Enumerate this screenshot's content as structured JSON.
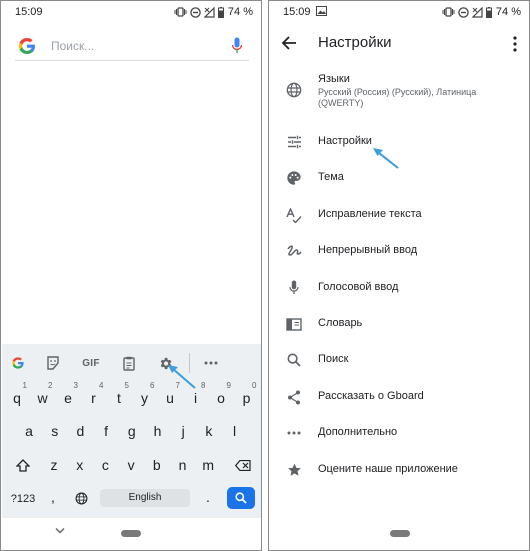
{
  "left_screen": {
    "status": {
      "time": "15:09",
      "battery": "74 %"
    },
    "search": {
      "placeholder": "Поиск..."
    },
    "keyboard": {
      "toolbar": {
        "icons": [
          "google-g-icon",
          "sticker-icon",
          "gif-icon",
          "clipboard-icon",
          "gear-icon",
          "more-horizontal-icon"
        ],
        "gif_label": "GIF"
      },
      "row1": [
        {
          "key": "q",
          "hint": "1"
        },
        {
          "key": "w",
          "hint": "2"
        },
        {
          "key": "e",
          "hint": "3"
        },
        {
          "key": "r",
          "hint": "4"
        },
        {
          "key": "t",
          "hint": "5"
        },
        {
          "key": "y",
          "hint": "6"
        },
        {
          "key": "u",
          "hint": "7"
        },
        {
          "key": "i",
          "hint": "8"
        },
        {
          "key": "o",
          "hint": "9"
        },
        {
          "key": "p",
          "hint": "0"
        }
      ],
      "row2": [
        "a",
        "s",
        "d",
        "f",
        "g",
        "h",
        "j",
        "k",
        "l"
      ],
      "row3": [
        "z",
        "x",
        "c",
        "v",
        "b",
        "n",
        "m"
      ],
      "row4": {
        "symbols": "?123",
        "comma": ",",
        "space": "English",
        "period": "."
      }
    }
  },
  "right_screen": {
    "status": {
      "time": "15:09",
      "battery": "74 %"
    },
    "appbar": {
      "title": "Настройки"
    },
    "menu": [
      {
        "icon": "globe-icon",
        "label": "Языки",
        "sub": "Русский (Россия) (Русский), Латиница (QWERTY)"
      },
      {
        "icon": "sliders-icon",
        "label": "Настройки"
      },
      {
        "icon": "palette-icon",
        "label": "Тема"
      },
      {
        "icon": "spellcheck-icon",
        "label": "Исправление текста"
      },
      {
        "icon": "gesture-icon",
        "label": "Непрерывный ввод"
      },
      {
        "icon": "mic-icon",
        "label": "Голосовой ввод"
      },
      {
        "icon": "book-icon",
        "label": "Словарь"
      },
      {
        "icon": "search-icon",
        "label": "Поиск"
      },
      {
        "icon": "share-icon",
        "label": "Рассказать о Gboard"
      },
      {
        "icon": "more-horizontal-icon",
        "label": "Дополнительно"
      },
      {
        "icon": "star-icon",
        "label": "Оцените наше приложение"
      }
    ]
  },
  "colors": {
    "accent": "#1a73e8",
    "annotation_arrow": "#3b9ee0",
    "keyboard_bg": "#edf0f2"
  }
}
